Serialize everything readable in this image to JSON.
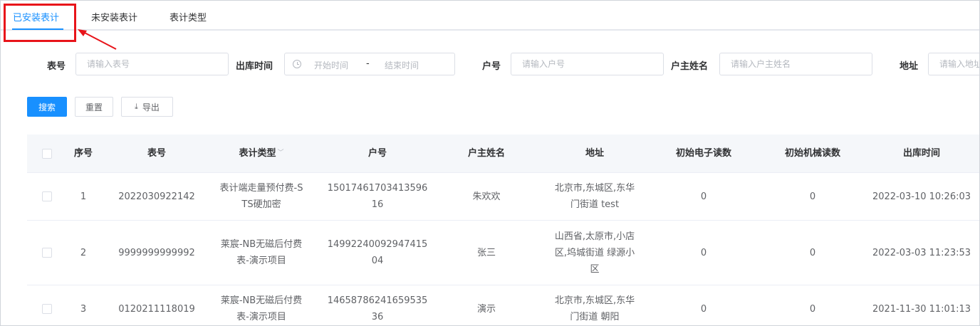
{
  "tabs": [
    {
      "label": "已安装表计",
      "active": true
    },
    {
      "label": "未安装表计",
      "active": false
    },
    {
      "label": "表计类型",
      "active": false
    }
  ],
  "filters": {
    "meter_no": {
      "label": "表号",
      "placeholder": "请输入表号"
    },
    "out_time": {
      "label": "出库时间",
      "start_placeholder": "开始时间",
      "separator": "-",
      "end_placeholder": "结束时间"
    },
    "account_no": {
      "label": "户号",
      "placeholder": "请输入户号"
    },
    "owner_name": {
      "label": "户主姓名",
      "placeholder": "请输入户主姓名"
    },
    "address": {
      "label": "地址",
      "placeholder": "请输入地址"
    }
  },
  "buttons": {
    "search": "搜索",
    "reset": "重置",
    "export": "导出"
  },
  "table": {
    "headers": {
      "index": "序号",
      "meter_no": "表号",
      "meter_type": "表计类型",
      "account_no": "户号",
      "owner_name": "户主姓名",
      "address": "地址",
      "init_electronic": "初始电子读数",
      "init_mechanical": "初始机械读数",
      "out_time": "出库时间"
    },
    "rows": [
      {
        "index": "1",
        "meter_no": "2022030922142",
        "meter_type": [
          "表计端走量预付费-S",
          "TS硬加密"
        ],
        "account_no": [
          "15017461703413596",
          "16"
        ],
        "owner_name": "朱欢欢",
        "address": [
          "北京市,东城区,东华",
          "门街道 test"
        ],
        "init_electronic": "0",
        "init_mechanical": "0",
        "out_time": "2022-03-10 10:26:03"
      },
      {
        "index": "2",
        "meter_no": "9999999999992",
        "meter_type": [
          "莱宸-NB无磁后付费",
          "表-演示项目"
        ],
        "account_no": [
          "14992240092947415",
          "04"
        ],
        "owner_name": "张三",
        "address": [
          "山西省,太原市,小店",
          "区,坞城街道 绿源小",
          "区"
        ],
        "init_electronic": "0",
        "init_mechanical": "0",
        "out_time": "2022-03-03 11:23:53"
      },
      {
        "index": "3",
        "meter_no": "0120211118019",
        "meter_type": [
          "莱宸-NB无磁后付费",
          "表-演示项目"
        ],
        "account_no": [
          "14658786241659535",
          "36"
        ],
        "owner_name": "演示",
        "address": [
          "北京市,东城区,东华",
          "门街道 朝阳"
        ],
        "init_electronic": "0",
        "init_mechanical": "0",
        "out_time": "2021-11-30 11:01:13"
      }
    ]
  },
  "colors": {
    "accent": "#1890ff",
    "annotation": "#e8141a"
  }
}
